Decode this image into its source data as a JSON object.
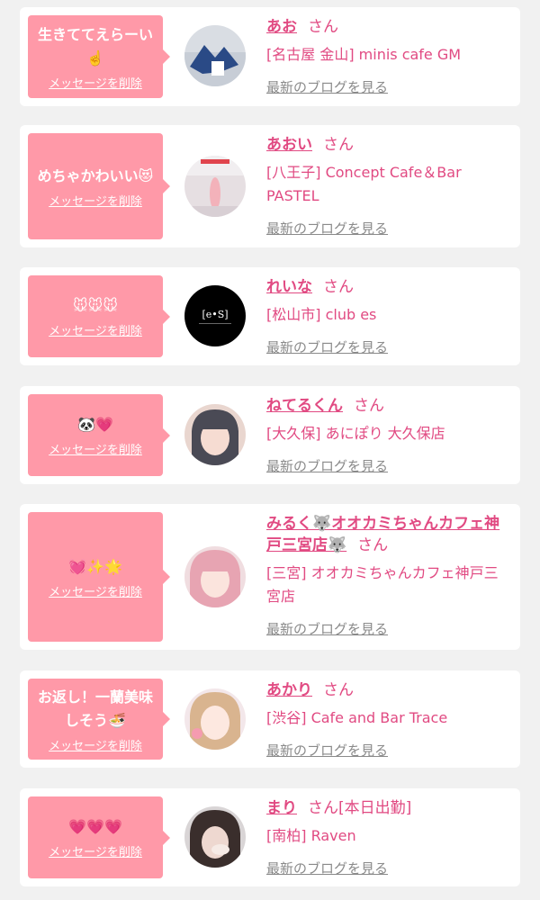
{
  "delete_label": "メッセージを削除",
  "san_label": "さん",
  "blog_label": "最新のブログを見る",
  "colors": {
    "bubble": "#ff99a8",
    "accent": "#e14a82",
    "muted": "#8a8a8a",
    "background": "#f1f1f1"
  },
  "cards": [
    {
      "message": "生きててえらーい☝️",
      "name": "あお",
      "tag": "",
      "shop": "[名古屋 金山] minis cafe GM",
      "avatar": "photo-blue"
    },
    {
      "message": "めちゃかわいい😻",
      "name": "あおい",
      "tag": "",
      "shop": "[八王子] Concept Cafe＆Bar PASTEL",
      "avatar": "photo-pink"
    },
    {
      "message": "🐭🐭🐭",
      "name": "れいな",
      "tag": "",
      "shop": "[松山市] club es",
      "avatar": "logo-es"
    },
    {
      "message": "🐼💗",
      "name": "ねてるくん",
      "tag": "",
      "shop": "[大久保] あにぽり 大久保店",
      "avatar": "photo-girl"
    },
    {
      "message": "💓✨🌟",
      "name": "みるく🐺オオカミちゃんカフェ神戸三宮店🐺",
      "tag": "",
      "shop": "[三宮] オオカミちゃんカフェ神戸三宮店",
      "avatar": "photo-girl-pink"
    },
    {
      "message": "お返し！一蘭美味しそう🍜",
      "name": "あかり",
      "tag": "",
      "shop": "[渋谷] Cafe and Bar Trace",
      "avatar": "photo-girl-light"
    },
    {
      "message": "💗💗💗",
      "name": "まり",
      "tag": "[本日出勤]",
      "shop": "[南柏] Raven",
      "avatar": "photo-girl-dark"
    }
  ]
}
